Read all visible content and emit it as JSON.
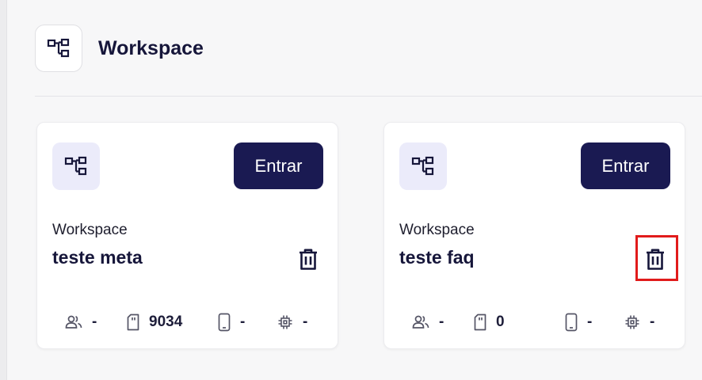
{
  "header": {
    "title": "Workspace",
    "icon": "workspace-tree-icon"
  },
  "workspaces": [
    {
      "label": "Workspace",
      "name": "teste meta",
      "enter_label": "Entrar",
      "stats": {
        "users": "-",
        "storage": "9034",
        "devices": "-",
        "cpu": "-"
      }
    },
    {
      "label": "Workspace",
      "name": "teste faq",
      "enter_label": "Entrar",
      "stats": {
        "users": "-",
        "storage": "0",
        "devices": "-",
        "cpu": "-"
      }
    }
  ],
  "colors": {
    "primary": "#1a1a52",
    "icon_bg": "#ebebfa",
    "highlight": "#e11b1b",
    "page_bg": "#f7f7f8"
  }
}
